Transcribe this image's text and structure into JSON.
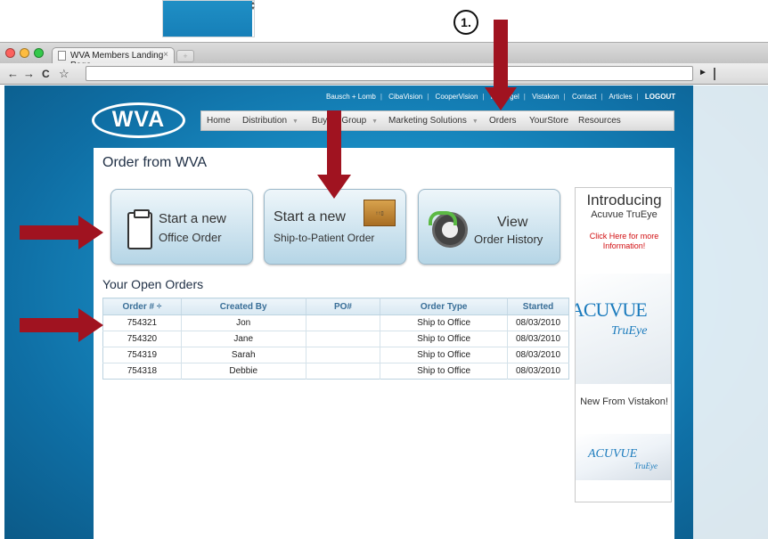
{
  "browser": {
    "tab_title": "WVA Members Landing Page",
    "tab_close": "×",
    "back": "←",
    "forward": "→",
    "reload": "C",
    "star": "☆",
    "go": "►"
  },
  "top_links": [
    "Bausch + Lomb",
    "CibaVision",
    "CooperVision",
    "Hydrogel",
    "Vistakon",
    "Contact",
    "Articles",
    "LOGOUT"
  ],
  "logo": "WVA",
  "nav": {
    "home": "Home",
    "distribution": "Distribution",
    "buying_group": "Buying Group",
    "marketing": "Marketing Solutions",
    "orders": "Orders",
    "yourstore": "YourStore",
    "resources": "Resources",
    "caret": "▼"
  },
  "page_title": "Order from WVA",
  "actions": {
    "office": {
      "l1": "Start a new",
      "l2": "Office Order"
    },
    "ship": {
      "l1": "Start a new",
      "l2": "Ship-to-Patient Order"
    },
    "history": {
      "l1": "View",
      "l2": "Order History"
    }
  },
  "open_orders": {
    "heading": "Your Open Orders",
    "columns": [
      "Order # ÷",
      "Created By",
      "PO#",
      "Order Type",
      "Started"
    ],
    "rows": [
      [
        "754321",
        "Jon",
        "",
        "Ship to Office",
        "08/03/2010"
      ],
      [
        "754320",
        "Jane",
        "",
        "Ship to Office",
        "08/03/2010"
      ],
      [
        "754319",
        "Sarah",
        "",
        "Ship to Office",
        "08/03/2010"
      ],
      [
        "754318",
        "Debbie",
        "",
        "Ship to Office",
        "08/03/2010"
      ]
    ]
  },
  "ad": {
    "introducing": "Introducing",
    "product": "Acuvue TruEye",
    "cta": "Click Here for more Information!",
    "logo_text": "ACUVUE",
    "logo_sub": "TruEye",
    "new_from": "New From Vistakon!",
    "logo2_text": "ACUVUE",
    "logo2_sub": "TruEye"
  },
  "annotation": {
    "step": "1."
  }
}
